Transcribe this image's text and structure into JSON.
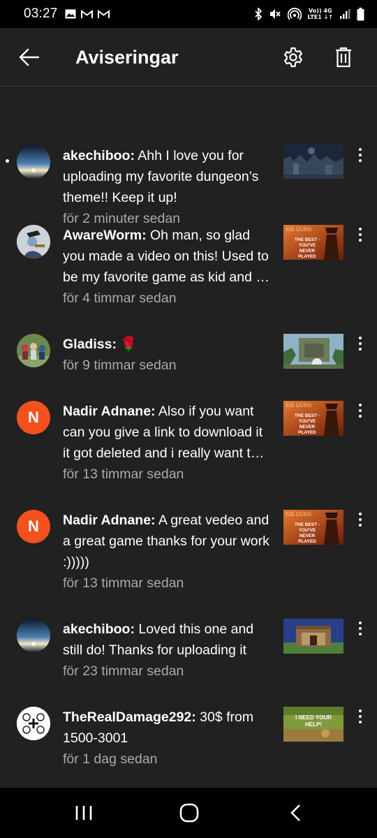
{
  "status_bar": {
    "time": "03:27",
    "net_top": "Vo)) 4G",
    "net_bottom": "LTE1 ↓↑"
  },
  "header": {
    "title": "Aviseringar",
    "back_icon": "arrow-left-icon",
    "settings_icon": "gear-icon",
    "delete_icon": "trash-icon"
  },
  "notifications": [
    {
      "author": "akechiboo:",
      "text": " Ahh I love you for uploading my favorite dungeon’s theme!! Keep it up!",
      "time": "för 2 minuter sedan",
      "unread": true,
      "avatar": "sunset-avatar",
      "thumbnail": "dark-castle-thumbnail"
    },
    {
      "author": "AwareWorm:",
      "text": " Oh man, so glad you made a video on this! Used to be my favorite game as kid and it still is! Thanks",
      "time": "för 4 timmar sedan",
      "avatar": "character-avatar",
      "thumbnail": "six-guns-thumbnail",
      "thumbnail_text_top": "SIX GUNS",
      "thumbnail_text_bottom": "THE BEST - YOU'VE NEVER PLAYED"
    },
    {
      "author": "Gladiss:",
      "text": " 🌹",
      "time": "för 9 timmar sedan",
      "avatar": "group-photo-avatar",
      "thumbnail": "jungle-temple-thumbnail"
    },
    {
      "author": "Nadir Adnane:",
      "text": " Also if you want can you give a link to download it it got deleted and i really want to play it again",
      "time": "för 13 timmar sedan",
      "avatar_letter": "N",
      "thumbnail": "six-guns-thumbnail",
      "thumbnail_text_top": "SIX GUNS",
      "thumbnail_text_bottom": "THE BEST - YOU'VE NEVER PLAYED"
    },
    {
      "author": "Nadir Adnane:",
      "text": " A great vedeo and a great game thanks for your work :)))))",
      "time": "för 13 timmar sedan",
      "avatar_letter": "N",
      "thumbnail": "six-guns-thumbnail",
      "thumbnail_text_top": "SIX GUNS",
      "thumbnail_text_bottom": "THE BEST - YOU'VE NEVER PLAYED"
    },
    {
      "author": "akechiboo:",
      "text": " Loved this one and still do! Thanks for uploading it",
      "time": "för 23 timmar sedan",
      "avatar": "sunset-avatar",
      "thumbnail": "temple-gate-thumbnail"
    },
    {
      "author": "TheRealDamage292:",
      "text": " 30$ from 1500-3001",
      "time": "för 1 dag sedan",
      "avatar": "symbols-avatar",
      "thumbnail": "i-need-your-help-thumbnail",
      "thumbnail_text_top": "I NEED YOUR",
      "thumbnail_text_bottom": "HELP!"
    }
  ],
  "nav_bar": {
    "recents_icon": "recent-apps-icon",
    "home_icon": "home-icon",
    "back_icon": "back-chevron-icon"
  }
}
